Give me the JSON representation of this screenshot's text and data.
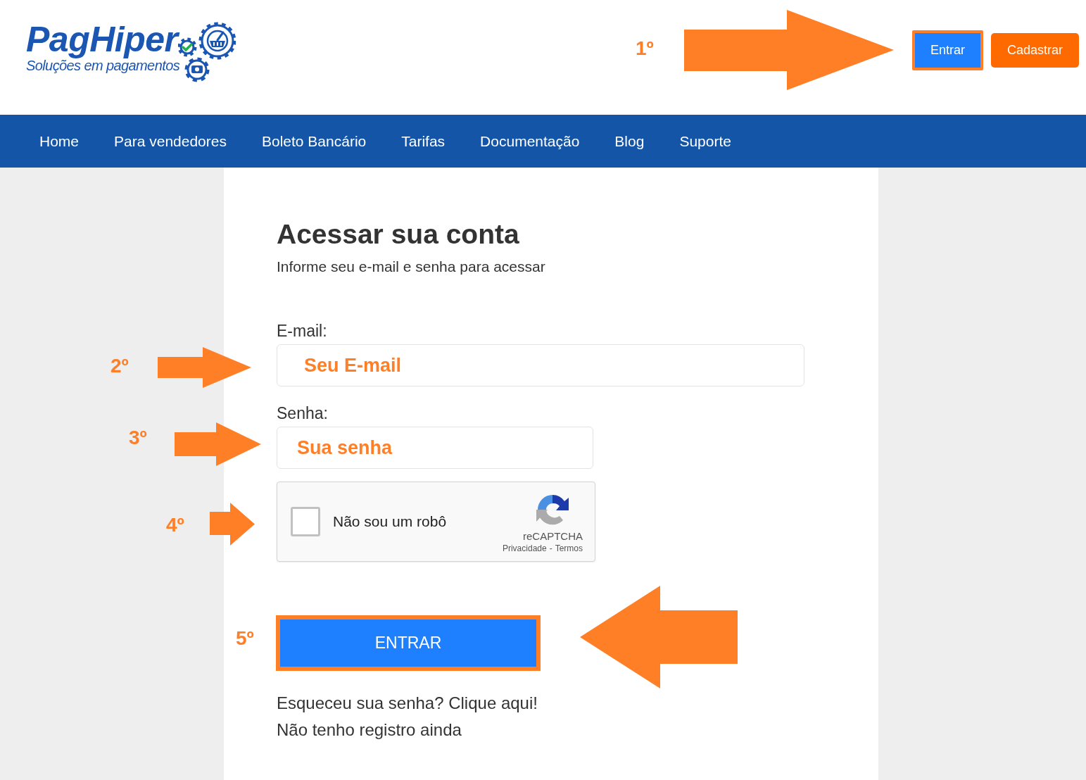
{
  "header": {
    "logo": {
      "wordmark": "PagHiper",
      "tagline": "Soluções em pagamentos"
    },
    "buttons": [
      {
        "label": "Entrar",
        "kind": "primary",
        "highlighted": true
      },
      {
        "label": "Cadastrar",
        "kind": "secondary",
        "highlighted": false
      }
    ]
  },
  "nav": {
    "items": [
      "Home",
      "Para vendedores",
      "Boleto Bancário",
      "Tarifas",
      "Documentação",
      "Blog",
      "Suporte"
    ]
  },
  "login": {
    "title": "Acessar sua conta",
    "subtitle": "Informe seu e-mail e senha para acessar",
    "fields": [
      {
        "kind": "email",
        "label": "E-mail:",
        "placeholder": "Seu E-mail"
      },
      {
        "kind": "password",
        "label": "Senha:",
        "placeholder": "Sua senha"
      }
    ],
    "captcha": {
      "label": "Não sou um robô",
      "checked": false,
      "brand": "reCAPTCHA",
      "links": [
        "Privacidade",
        "Termos"
      ],
      "separator": "-"
    },
    "submit": {
      "label": "ENTRAR",
      "highlighted": true
    },
    "links": [
      "Esqueceu sua senha? Clique aqui!",
      "Não tenho registro ainda"
    ]
  },
  "annotations": [
    {
      "label": "1º",
      "kind": "arrow_right"
    },
    {
      "label": "2º",
      "kind": "arrow_right"
    },
    {
      "label": "3º",
      "kind": "arrow_right"
    },
    {
      "label": "4º",
      "kind": "arrow_right"
    },
    {
      "label": "5º",
      "kind": "arrow_left"
    }
  ]
}
